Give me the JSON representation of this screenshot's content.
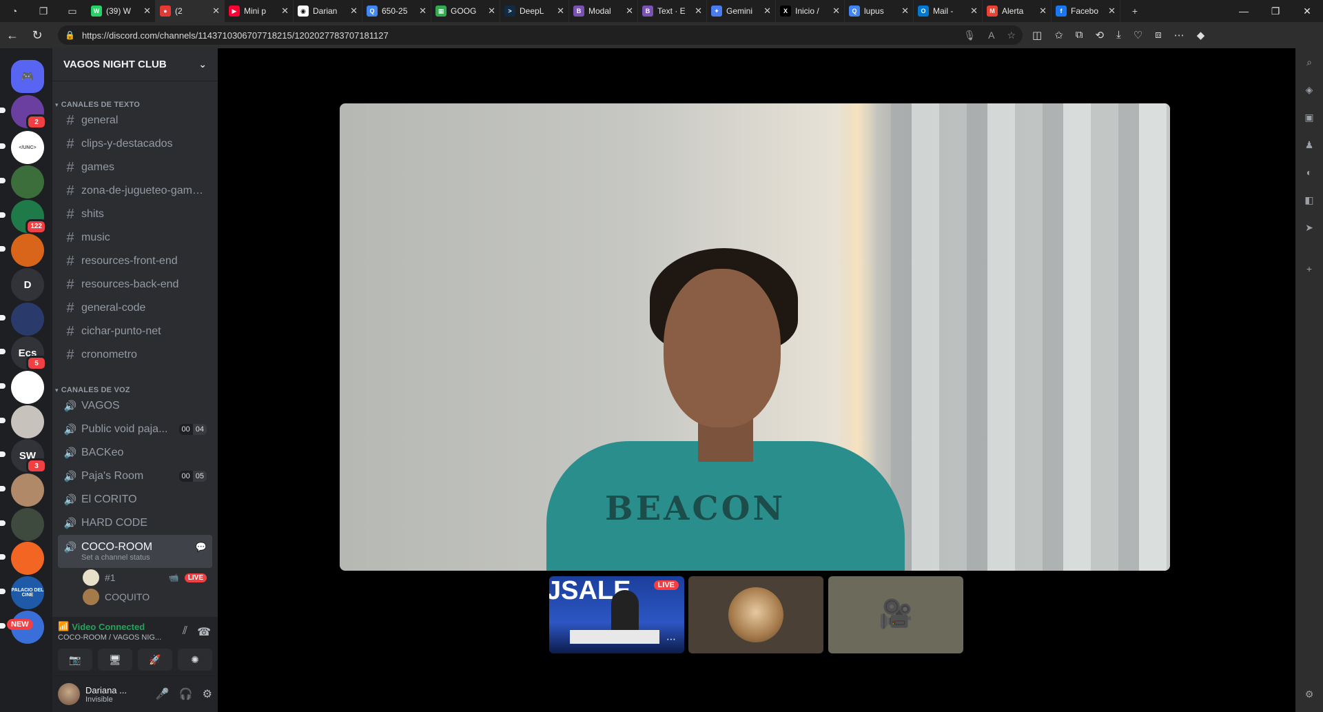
{
  "browser": {
    "tabs": [
      {
        "title": "(39) W",
        "color": "#25d366",
        "letter": "W"
      },
      {
        "title": "(2",
        "color": "#e53935",
        "letter": "●",
        "active": true
      },
      {
        "title": "Mini p",
        "color": "#ff0033",
        "letter": "▶"
      },
      {
        "title": "Darian",
        "color": "#ffffff",
        "letter": "◉"
      },
      {
        "title": "650-25",
        "color": "#4285f4",
        "letter": "Q"
      },
      {
        "title": "GOOG",
        "color": "#34a853",
        "letter": "▦"
      },
      {
        "title": "DeepL",
        "color": "#0f2b46",
        "letter": ">"
      },
      {
        "title": "Modal",
        "color": "#7952b3",
        "letter": "B"
      },
      {
        "title": "Text · E",
        "color": "#7952b3",
        "letter": "B"
      },
      {
        "title": "Gemini",
        "color": "#4a7cf0",
        "letter": "✦"
      },
      {
        "title": "Inicio /",
        "color": "#000000",
        "letter": "X"
      },
      {
        "title": "lupus",
        "color": "#4285f4",
        "letter": "Q"
      },
      {
        "title": "Mail -",
        "color": "#0078d4",
        "letter": "O"
      },
      {
        "title": "Alerta",
        "color": "#ea4335",
        "letter": "M"
      },
      {
        "title": "Facebo",
        "color": "#1877f2",
        "letter": "f"
      }
    ],
    "url": "https://discord.com/channels/1143710306707718215/1202027783707181127"
  },
  "discord": {
    "server_name": "VAGOS NIGHT CLUB",
    "servers": [
      {
        "label": "",
        "color": "#5865f2",
        "badge": "",
        "top": 0
      },
      {
        "label": "",
        "color": "#6b3fa0",
        "badge": "2"
      },
      {
        "label": "</UNC>",
        "color": "#ffffff",
        "badge": ""
      },
      {
        "label": "",
        "color": "#3b6e3b",
        "badge": ""
      },
      {
        "label": "",
        "color": "#1f7a4a",
        "badge": "122"
      },
      {
        "label": "",
        "color": "#d9651a",
        "badge": ""
      },
      {
        "label": "D",
        "color": "#313338",
        "badge": ""
      },
      {
        "label": "",
        "color": "#2a3a6a",
        "badge": ""
      },
      {
        "label": "Ecs",
        "color": "#313338",
        "badge": "5"
      },
      {
        "label": "",
        "color": "#ffffff",
        "badge": ""
      },
      {
        "label": "",
        "color": "#c7c2bb",
        "badge": ""
      },
      {
        "label": "SW",
        "color": "#313338",
        "badge": "3"
      },
      {
        "label": "",
        "color": "#b08968",
        "badge": ""
      },
      {
        "label": "",
        "color": "#3d4a3d",
        "badge": ""
      },
      {
        "label": "",
        "color": "#f26522",
        "badge": ""
      },
      {
        "label": "PALACIO DEL CINE",
        "color": "#1e5aa8",
        "badge": ""
      },
      {
        "label": "",
        "color": "#3a6ed8",
        "badge": "NEW"
      }
    ],
    "text_category": "CANALES DE TEXTO",
    "text_channels": [
      "general",
      "clips-y-destacados",
      "games",
      "zona-de-jugueteo-game...",
      "shits",
      "music",
      "resources-front-end",
      "resources-back-end",
      "general-code",
      "cichar-punto-net",
      "cronometro"
    ],
    "voice_category": "CANALES DE VOZ",
    "voice_channels": [
      {
        "name": "VAGOS",
        "count": [
          "",
          ""
        ]
      },
      {
        "name": "Public void paja...",
        "count": [
          "00",
          "04"
        ]
      },
      {
        "name": "BACKeo",
        "count": [
          "",
          ""
        ]
      },
      {
        "name": "Paja's Room",
        "count": [
          "00",
          "05"
        ]
      },
      {
        "name": "El CORITO",
        "count": [
          "",
          ""
        ]
      },
      {
        "name": "HARD CODE",
        "count": [
          "",
          ""
        ]
      }
    ],
    "selected_voice": {
      "name": "COCO-ROOM",
      "sub": "Set a channel status"
    },
    "members": [
      {
        "name": "#1",
        "live": "LIVE"
      },
      {
        "name": "COQUITO",
        "live": ""
      }
    ],
    "voice_status": {
      "title": "Video Connected",
      "sub": "COCO-ROOM / VAGOS NIG..."
    },
    "user": {
      "name": "Dariana ...",
      "status": "Invisible"
    },
    "stage": {
      "shirt_text": "BEACON",
      "news_text": "JSALE",
      "live_label": "LIVE"
    }
  }
}
